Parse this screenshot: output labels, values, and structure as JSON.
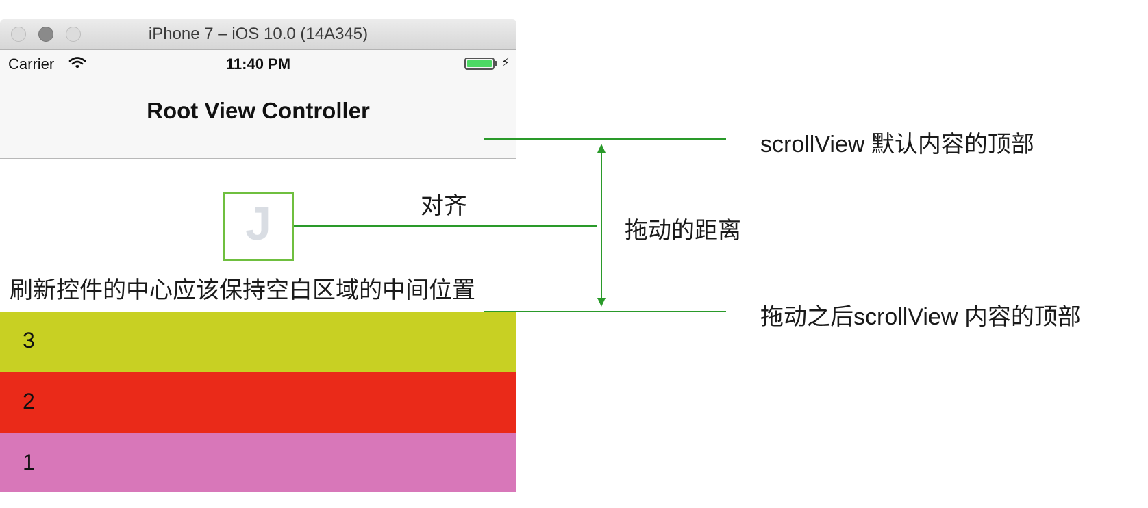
{
  "window": {
    "title": "iPhone 7 – iOS 10.0 (14A345)"
  },
  "status_bar": {
    "carrier": "Carrier",
    "time": "11:40 PM",
    "bolt": "⚡"
  },
  "nav": {
    "title": "Root View Controller"
  },
  "refresh_control": {
    "glyph": "J"
  },
  "caption": "刷新控件的中心应该保持空白区域的中间位置",
  "rows": [
    "3",
    "2",
    "1"
  ],
  "annotations": {
    "default_top": "scrollView 默认内容的顶部",
    "align": "对齐",
    "drag_distance": "拖动的距离",
    "after_drag_top": "拖动之后scrollView 内容的顶部"
  },
  "colors": {
    "row_3": "#c8d023",
    "row_2": "#ea2a19",
    "row_1": "#d877b9",
    "annotation_line": "#2a9a2a",
    "refresh_border": "#6fbf3f",
    "battery": "#4cd964"
  },
  "icons": {
    "wifi": "wifi-icon",
    "battery": "battery-icon",
    "charging": "charging-bolt-icon",
    "refresh": "refresh-spinner-icon"
  }
}
